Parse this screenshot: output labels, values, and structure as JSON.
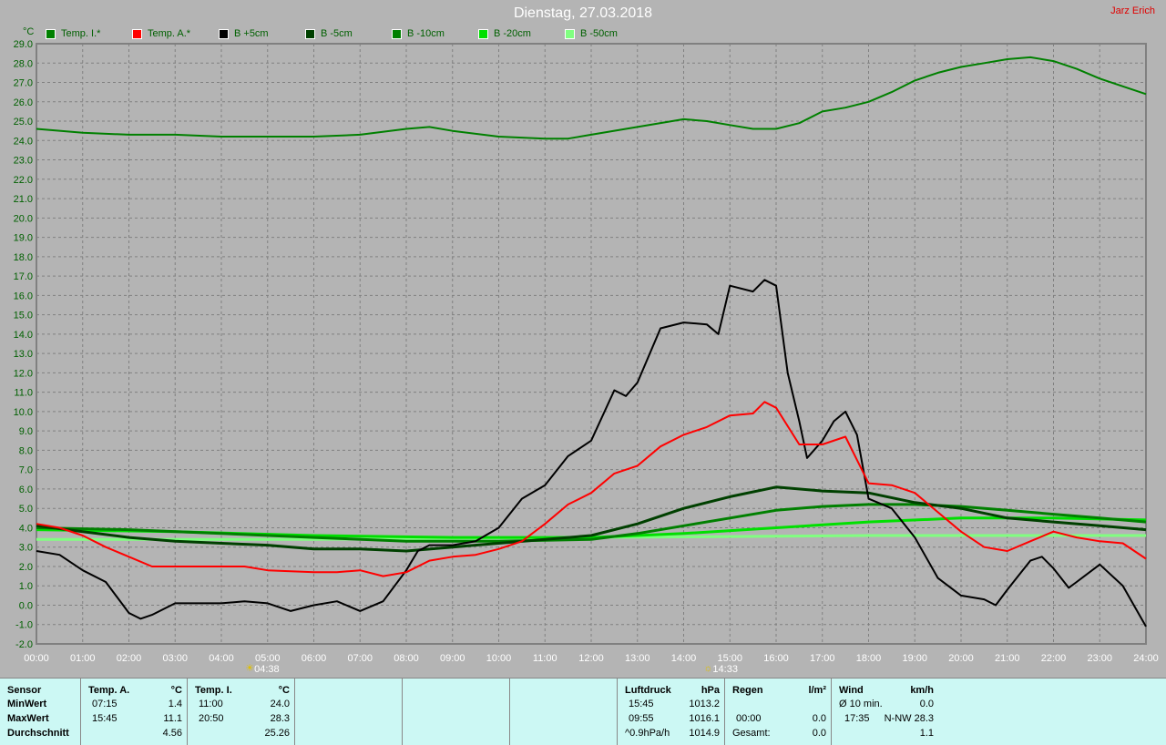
{
  "title": "Dienstag, 27.03.2018",
  "author": "Jarz Erich",
  "legend": [
    {
      "label": "Temp. I.*",
      "color": "#008000"
    },
    {
      "label": "Temp. A.*",
      "color": "#ff0000"
    },
    {
      "label": "B +5cm",
      "color": "#000000"
    },
    {
      "label": "B -5cm",
      "color": "#004000"
    },
    {
      "label": "B -10cm",
      "color": "#008000"
    },
    {
      "label": "B -20cm",
      "color": "#00e000"
    },
    {
      "label": "B -50cm",
      "color": "#80ff80"
    }
  ],
  "chart_data": {
    "type": "line",
    "title": "Dienstag, 27.03.2018",
    "ylabel": "°C",
    "ylim": [
      -2,
      29
    ],
    "xlim": [
      0,
      24
    ],
    "yticks": [
      "29.0",
      "28.0",
      "27.0",
      "26.0",
      "25.0",
      "24.0",
      "23.0",
      "22.0",
      "21.0",
      "20.0",
      "19.0",
      "18.0",
      "17.0",
      "16.0",
      "15.0",
      "14.0",
      "13.0",
      "12.0",
      "11.0",
      "10.0",
      "9.0",
      "8.0",
      "7.0",
      "6.0",
      "5.0",
      "4.0",
      "3.0",
      "2.0",
      "1.0",
      "0.0",
      "-1.0",
      "-2.0"
    ],
    "xticks": [
      "00:00",
      "01:00",
      "02:00",
      "03:00",
      "04:00",
      "05:00",
      "06:00",
      "07:00",
      "08:00",
      "09:00",
      "10:00",
      "11:00",
      "12:00",
      "13:00",
      "14:00",
      "15:00",
      "16:00",
      "17:00",
      "18:00",
      "19:00",
      "20:00",
      "21:00",
      "22:00",
      "23:00",
      "24:00"
    ],
    "grid": true,
    "markers": [
      {
        "label": "04:38",
        "x": 4.633,
        "icon": "sunrise"
      },
      {
        "label": "14:33",
        "x": 14.55,
        "icon": "sunset"
      }
    ],
    "series": [
      {
        "name": "Temp. I.*",
        "color": "#008000",
        "x": [
          0,
          1,
          2,
          3,
          4,
          5,
          6,
          7,
          8,
          8.5,
          9,
          10,
          11,
          11.5,
          12,
          13,
          14,
          14.5,
          15,
          15.5,
          16,
          16.5,
          17,
          17.5,
          18,
          18.5,
          19,
          19.5,
          20,
          20.5,
          21,
          21.5,
          22,
          22.5,
          23,
          23.5,
          24
        ],
        "y": [
          24.6,
          24.4,
          24.3,
          24.3,
          24.2,
          24.2,
          24.2,
          24.3,
          24.6,
          24.7,
          24.5,
          24.2,
          24.1,
          24.1,
          24.3,
          24.7,
          25.1,
          25.0,
          24.8,
          24.6,
          24.6,
          24.9,
          25.5,
          25.7,
          26.0,
          26.5,
          27.1,
          27.5,
          27.8,
          28.0,
          28.2,
          28.3,
          28.1,
          27.7,
          27.2,
          26.8,
          26.4
        ]
      },
      {
        "name": "Temp. A.*",
        "color": "#ff0000",
        "x": [
          0,
          0.5,
          1,
          1.5,
          2,
          2.5,
          3,
          4,
          4.5,
          5,
          6,
          6.5,
          7,
          7.5,
          8,
          8.5,
          9,
          9.5,
          10,
          10.5,
          11,
          11.5,
          12,
          12.5,
          13,
          13.5,
          14,
          14.5,
          15,
          15.5,
          15.75,
          16,
          16.5,
          17,
          17.5,
          18,
          18.5,
          19,
          19.5,
          20,
          20.5,
          21,
          21.5,
          22,
          22.5,
          23,
          23.5,
          24
        ],
        "y": [
          4.2,
          4.0,
          3.6,
          3.0,
          2.5,
          2.0,
          2.0,
          2.0,
          2.0,
          1.8,
          1.7,
          1.7,
          1.8,
          1.5,
          1.7,
          2.3,
          2.5,
          2.6,
          2.9,
          3.3,
          4.2,
          5.2,
          5.8,
          6.8,
          7.2,
          8.2,
          8.8,
          9.2,
          9.8,
          9.9,
          10.5,
          10.2,
          8.3,
          8.3,
          8.7,
          6.3,
          6.2,
          5.8,
          4.8,
          3.8,
          3.0,
          2.8,
          3.3,
          3.8,
          3.5,
          3.3,
          3.2,
          2.4
        ]
      },
      {
        "name": "B +5cm",
        "color": "#000000",
        "x": [
          0,
          0.5,
          1,
          1.5,
          2,
          2.25,
          2.5,
          3,
          4,
          4.5,
          5,
          5.5,
          6,
          6.5,
          7,
          7.5,
          8,
          8.25,
          8.5,
          9,
          9.5,
          10,
          10.5,
          11,
          11.5,
          12,
          12.5,
          12.75,
          13,
          13.5,
          14,
          14.5,
          14.75,
          15,
          15.5,
          15.75,
          16,
          16.25,
          16.5,
          16.67,
          17,
          17.25,
          17.5,
          17.75,
          18,
          18.5,
          19,
          19.5,
          20,
          20.5,
          20.75,
          21,
          21.5,
          21.75,
          22,
          22.33,
          22.5,
          23,
          23.5,
          24
        ],
        "y": [
          2.8,
          2.6,
          1.8,
          1.2,
          -0.4,
          -0.7,
          -0.5,
          0.1,
          0.1,
          0.2,
          0.1,
          -0.3,
          0.0,
          0.2,
          -0.3,
          0.2,
          1.8,
          2.8,
          3.1,
          3.1,
          3.3,
          4.0,
          5.5,
          6.2,
          7.7,
          8.5,
          11.1,
          10.8,
          11.5,
          14.3,
          14.6,
          14.5,
          14.0,
          16.5,
          16.2,
          16.8,
          16.5,
          12.0,
          9.5,
          7.6,
          8.5,
          9.5,
          10.0,
          8.8,
          5.5,
          5.0,
          3.5,
          1.4,
          0.5,
          0.3,
          0.0,
          0.8,
          2.3,
          2.5,
          1.9,
          0.9,
          1.2,
          2.1,
          1.0,
          -1.1
        ]
      },
      {
        "name": "B -5cm",
        "color": "#004000",
        "x": [
          0,
          1,
          2,
          3,
          4,
          5,
          6,
          7,
          8,
          9,
          10,
          11,
          12,
          13,
          14,
          15,
          16,
          17,
          18,
          19,
          20,
          21,
          22,
          23,
          24
        ],
        "y": [
          4.1,
          3.8,
          3.5,
          3.3,
          3.2,
          3.1,
          2.9,
          2.9,
          2.8,
          3.0,
          3.2,
          3.4,
          3.6,
          4.2,
          5.0,
          5.6,
          6.1,
          5.9,
          5.8,
          5.3,
          5.0,
          4.5,
          4.3,
          4.1,
          3.9
        ]
      },
      {
        "name": "B -10cm",
        "color": "#008000",
        "x": [
          0,
          2,
          4,
          6,
          8,
          10,
          12,
          13,
          14,
          15,
          16,
          17,
          18,
          19,
          20,
          21,
          22,
          23,
          24
        ],
        "y": [
          4.0,
          3.9,
          3.7,
          3.5,
          3.3,
          3.3,
          3.4,
          3.7,
          4.1,
          4.5,
          4.9,
          5.1,
          5.2,
          5.2,
          5.1,
          4.9,
          4.7,
          4.5,
          4.3
        ]
      },
      {
        "name": "B -20cm",
        "color": "#00e000",
        "x": [
          0,
          3,
          6,
          9,
          12,
          14,
          16,
          18,
          20,
          22,
          24
        ],
        "y": [
          3.9,
          3.8,
          3.6,
          3.5,
          3.5,
          3.7,
          4.0,
          4.3,
          4.5,
          4.5,
          4.4
        ]
      },
      {
        "name": "B -50cm",
        "color": "#80ff80",
        "x": [
          0,
          6,
          12,
          18,
          24
        ],
        "y": [
          3.4,
          3.4,
          3.5,
          3.6,
          3.6
        ]
      }
    ]
  },
  "table": {
    "c1": [
      "Sensor",
      "MinWert",
      "MaxWert",
      "Durchschnitt"
    ],
    "tempA": {
      "head": "Temp. A.",
      "unit": "°C",
      "min_time": "07:15",
      "min": "1.4",
      "max_time": "15:45",
      "max": "11.1",
      "avg": "4.56"
    },
    "tempI": {
      "head": "Temp. I.",
      "unit": "°C",
      "min_time": "11:00",
      "min": "24.0",
      "max_time": "20:50",
      "max": "28.3",
      "avg": "25.26"
    },
    "luft": {
      "head": "Luftdruck",
      "unit": "hPa",
      "min_time": "15:45",
      "min": "1013.2",
      "max_time": "09:55",
      "max": "1016.1",
      "trend": "^0.9hPa/h",
      "avg": "1014.9"
    },
    "regen": {
      "head": "Regen",
      "unit": "l/m²",
      "max_time": "00:00",
      "max": "0.0",
      "total_label": "Gesamt:",
      "total": "0.0"
    },
    "wind": {
      "head": "Wind",
      "unit": "km/h",
      "avg_label": "Ø 10 min.",
      "avg": "0.0",
      "max_time": "17:35",
      "max": "N-NW 28.3",
      "mean": "1.1"
    }
  }
}
